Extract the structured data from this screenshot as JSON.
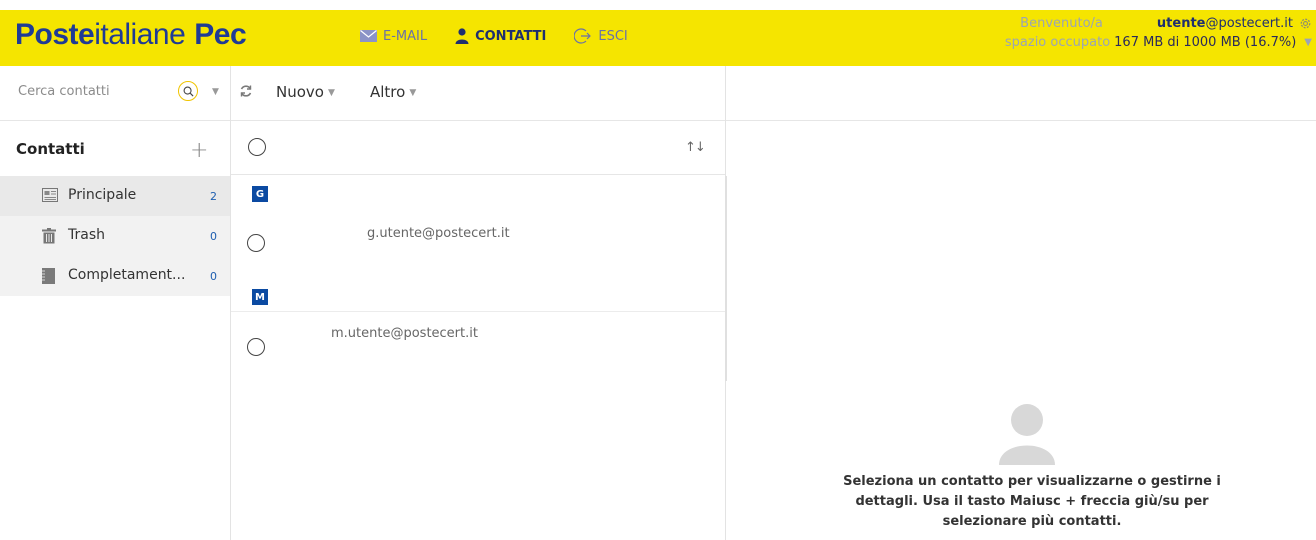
{
  "brand": {
    "part1": "Poste",
    "part2": "italiane",
    "part3": "Pec"
  },
  "nav": [
    {
      "label": "E-MAIL",
      "icon": "mail-icon"
    },
    {
      "label": "CONTATTI",
      "icon": "person-icon",
      "active": true
    },
    {
      "label": "ESCI",
      "icon": "logout-icon"
    }
  ],
  "account": {
    "welcome_label": "Benvenuto/a",
    "user_name": "utente",
    "user_domain": "@postecert.it",
    "space_label": "spazio occupato",
    "space_value": "167 MB di 1000 MB (16.7%)"
  },
  "search": {
    "placeholder": "Cerca contatti"
  },
  "toolbar": {
    "new_label": "Nuovo",
    "more_label": "Altro"
  },
  "sidebar": {
    "title": "Contatti",
    "items": [
      {
        "label": "Principale",
        "count": "2",
        "icon": "address-book-icon"
      },
      {
        "label": "Trash",
        "count": "0",
        "icon": "trash-icon"
      },
      {
        "label": "Completament...",
        "count": "0",
        "icon": "notebook-icon"
      }
    ]
  },
  "list": {
    "groups": [
      {
        "letter": "G",
        "email": "g.utente@postecert.it"
      },
      {
        "letter": "M",
        "email": "m.utente@postecert.it"
      }
    ]
  },
  "detail": {
    "message": "Seleziona un contatto per visualizzarne o gestirne i dettagli. Usa il tasto Maiusc + freccia giù/su per selezionare più contatti."
  },
  "colors": {
    "header_bg": "#f5e500",
    "brand_blue": "#1f3b95",
    "letter_badge": "#0b4aa2"
  }
}
